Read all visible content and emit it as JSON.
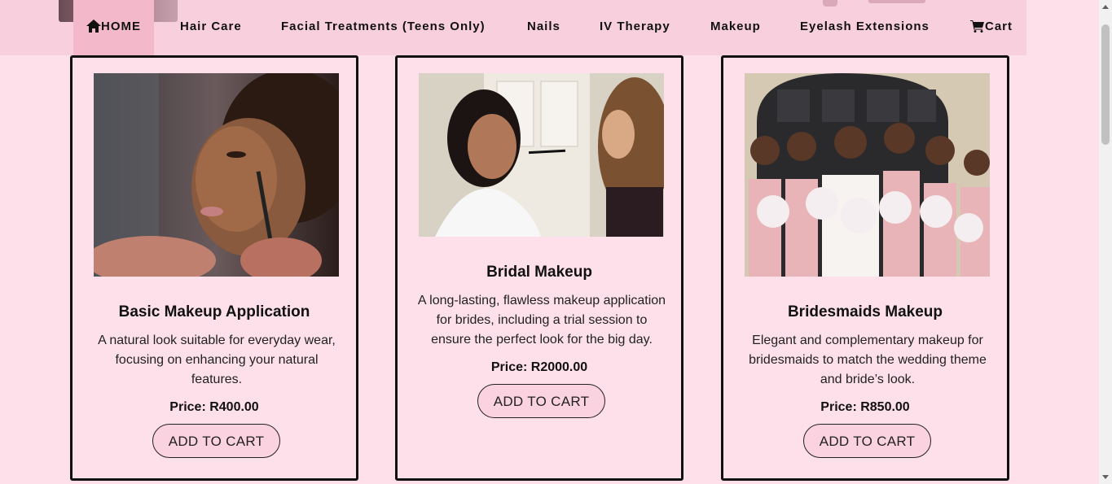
{
  "nav": {
    "items": [
      {
        "label": "HOME",
        "icon": "home-icon",
        "active": true
      },
      {
        "label": "Hair Care"
      },
      {
        "label": "Facial Treatments (Teens Only)"
      },
      {
        "label": "Nails"
      },
      {
        "label": "IV Therapy"
      },
      {
        "label": "Makeup"
      },
      {
        "label": "Eyelash Extensions"
      },
      {
        "label": "Cart",
        "icon": "cart-icon"
      }
    ]
  },
  "products": [
    {
      "title": "Basic Makeup Application",
      "description": "A natural look suitable for everyday wear, focusing on enhancing your natural features.",
      "price": "Price: R400.00",
      "button": "ADD TO CART",
      "image": "makeup-brush-model-photo"
    },
    {
      "title": "Bridal Makeup",
      "description": "A long-lasting, flawless makeup application for brides, including a trial session to ensure the perfect look for the big day.",
      "price": "Price: R2000.00",
      "button": "ADD TO CART",
      "image": "bride-makeup-photo"
    },
    {
      "title": "Bridesmaids Makeup",
      "description": "Elegant and complementary makeup for bridesmaids to match the wedding theme and bride’s look.",
      "price": "Price: R850.00",
      "button": "ADD TO CART",
      "image": "bridesmaids-group-photo"
    }
  ],
  "colors": {
    "background": "#fde0ea",
    "nav_background": "#f8d0dd",
    "nav_active": "#f3b9cb",
    "button_background": "#fbd3e0"
  }
}
